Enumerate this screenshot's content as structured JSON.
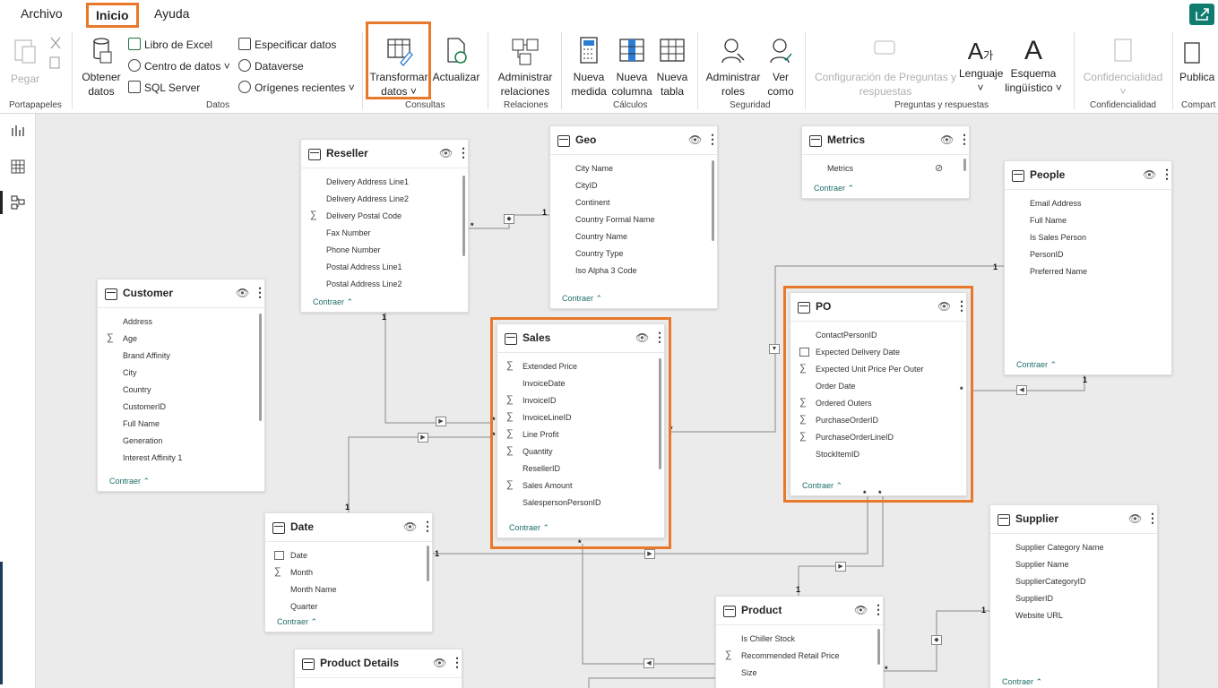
{
  "menu": {
    "archivo": "Archivo",
    "inicio": "Inicio",
    "ayuda": "Ayuda"
  },
  "ribbon": {
    "pegar": "Pegar",
    "obtener_datos_1": "Obtener",
    "obtener_datos_2": "datos",
    "libro_excel": "Libro de Excel",
    "centro_datos": "Centro de datos",
    "sql_server": "SQL Server",
    "especificar_datos": "Especificar datos",
    "dataverse": "Dataverse",
    "origenes_recientes": "Orígenes recientes",
    "transformar_1": "Transformar",
    "transformar_2": "datos",
    "actualizar": "Actualizar",
    "administrar_rel_1": "Administrar",
    "administrar_rel_2": "relaciones",
    "nueva_medida_1": "Nueva",
    "nueva_medida_2": "medida",
    "nueva_columna_1": "Nueva",
    "nueva_columna_2": "columna",
    "nueva_tabla_1": "Nueva",
    "nueva_tabla_2": "tabla",
    "administrar_roles_1": "Administrar",
    "administrar_roles_2": "roles",
    "ver_como_1": "Ver",
    "ver_como_2": "como",
    "config_qa_1": "Configuración de Preguntas y",
    "config_qa_2": "respuestas",
    "lenguaje": "Lenguaje",
    "esquema_1": "Esquema",
    "esquema_2": "lingüístico",
    "confidencialidad": "Confidencialidad",
    "publicar": "Publica",
    "groups": {
      "portapapeles": "Portapapeles",
      "datos": "Datos",
      "consultas": "Consultas",
      "relaciones": "Relaciones",
      "calculos": "Cálculos",
      "seguridad": "Seguridad",
      "preguntas": "Preguntas y respuestas",
      "confidencialidad": "Confidencialidad",
      "compartir": "Compart"
    }
  },
  "collapse_label": "Contraer",
  "tables": {
    "reseller": {
      "title": "Reseller",
      "fields": [
        "Delivery Address Line1",
        "Delivery Address Line2",
        "Delivery Postal Code",
        "Fax Number",
        "Phone Number",
        "Postal Address Line1",
        "Postal Address Line2"
      ]
    },
    "geo": {
      "title": "Geo",
      "fields": [
        "City Name",
        "CityID",
        "Continent",
        "Country Formal Name",
        "Country Name",
        "Country Type",
        "Iso Alpha 3 Code"
      ]
    },
    "metrics": {
      "title": "Metrics",
      "fields": [
        "Metrics"
      ]
    },
    "people": {
      "title": "People",
      "fields": [
        "Email Address",
        "Full Name",
        "Is Sales Person",
        "PersonID",
        "Preferred Name"
      ]
    },
    "customer": {
      "title": "Customer",
      "fields": [
        "Address",
        "Age",
        "Brand Affinity",
        "City",
        "Country",
        "CustomerID",
        "Full Name",
        "Generation",
        "Interest Affinity 1"
      ]
    },
    "sales": {
      "title": "Sales",
      "fields": [
        "Extended Price",
        "InvoiceDate",
        "InvoiceID",
        "InvoiceLineID",
        "Line Profit",
        "Quantity",
        "ResellerID",
        "Sales Amount",
        "SalespersonPersonID"
      ]
    },
    "po": {
      "title": "PO",
      "fields": [
        "ContactPersonID",
        "Expected Delivery Date",
        "Expected Unit Price Per Outer",
        "Order Date",
        "Ordered Outers",
        "PurchaseOrderID",
        "PurchaseOrderLineID",
        "StockItemID"
      ]
    },
    "date": {
      "title": "Date",
      "fields": [
        "Date",
        "Month",
        "Month Name",
        "Quarter"
      ]
    },
    "supplier": {
      "title": "Supplier",
      "fields": [
        "Supplier Category Name",
        "Supplier Name",
        "SupplierCategoryID",
        "SupplierID",
        "Website URL"
      ]
    },
    "product": {
      "title": "Product",
      "fields": [
        "Is Chiller Stock",
        "Recommended Retail Price",
        "Size"
      ]
    },
    "product_details": {
      "title": "Product Details",
      "fields": []
    }
  },
  "rel": {
    "one": "1",
    "many": "*"
  }
}
